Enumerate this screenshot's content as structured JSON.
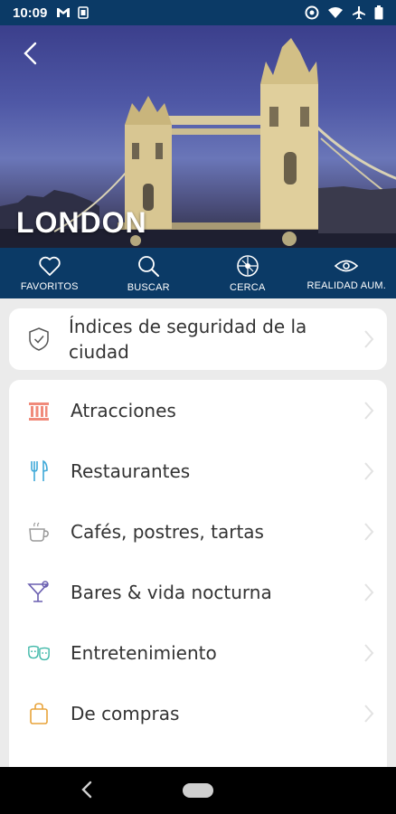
{
  "status": {
    "time": "10:09"
  },
  "hero": {
    "city": "LONDON"
  },
  "toolbar": {
    "items": [
      {
        "label": "FAVORITOS",
        "icon": "heart-icon"
      },
      {
        "label": "BUSCAR",
        "icon": "search-icon"
      },
      {
        "label": "CERCA",
        "icon": "compass-icon"
      },
      {
        "label": "REALIDAD AUM.",
        "icon": "eye-icon"
      }
    ]
  },
  "safety": {
    "label": "Índices de seguridad de la ciudad",
    "icon": "shield-check-icon"
  },
  "categories": [
    {
      "label": "Atracciones",
      "icon": "landmark-icon",
      "color": "#f08a7a"
    },
    {
      "label": "Restaurantes",
      "icon": "fork-knife-icon",
      "color": "#3fa9d8"
    },
    {
      "label": "Cafés, postres, tartas",
      "icon": "coffee-cup-icon",
      "color": "#9a9a9a"
    },
    {
      "label": "Bares & vida nocturna",
      "icon": "cocktail-icon",
      "color": "#6a5fb0"
    },
    {
      "label": "Entretenimiento",
      "icon": "theater-masks-icon",
      "color": "#3fb8a8"
    },
    {
      "label": "De compras",
      "icon": "shopping-bag-icon",
      "color": "#e8a33a"
    }
  ],
  "colors": {
    "primary": "#0b3a66",
    "background": "#ebebeb",
    "text": "#333333"
  }
}
